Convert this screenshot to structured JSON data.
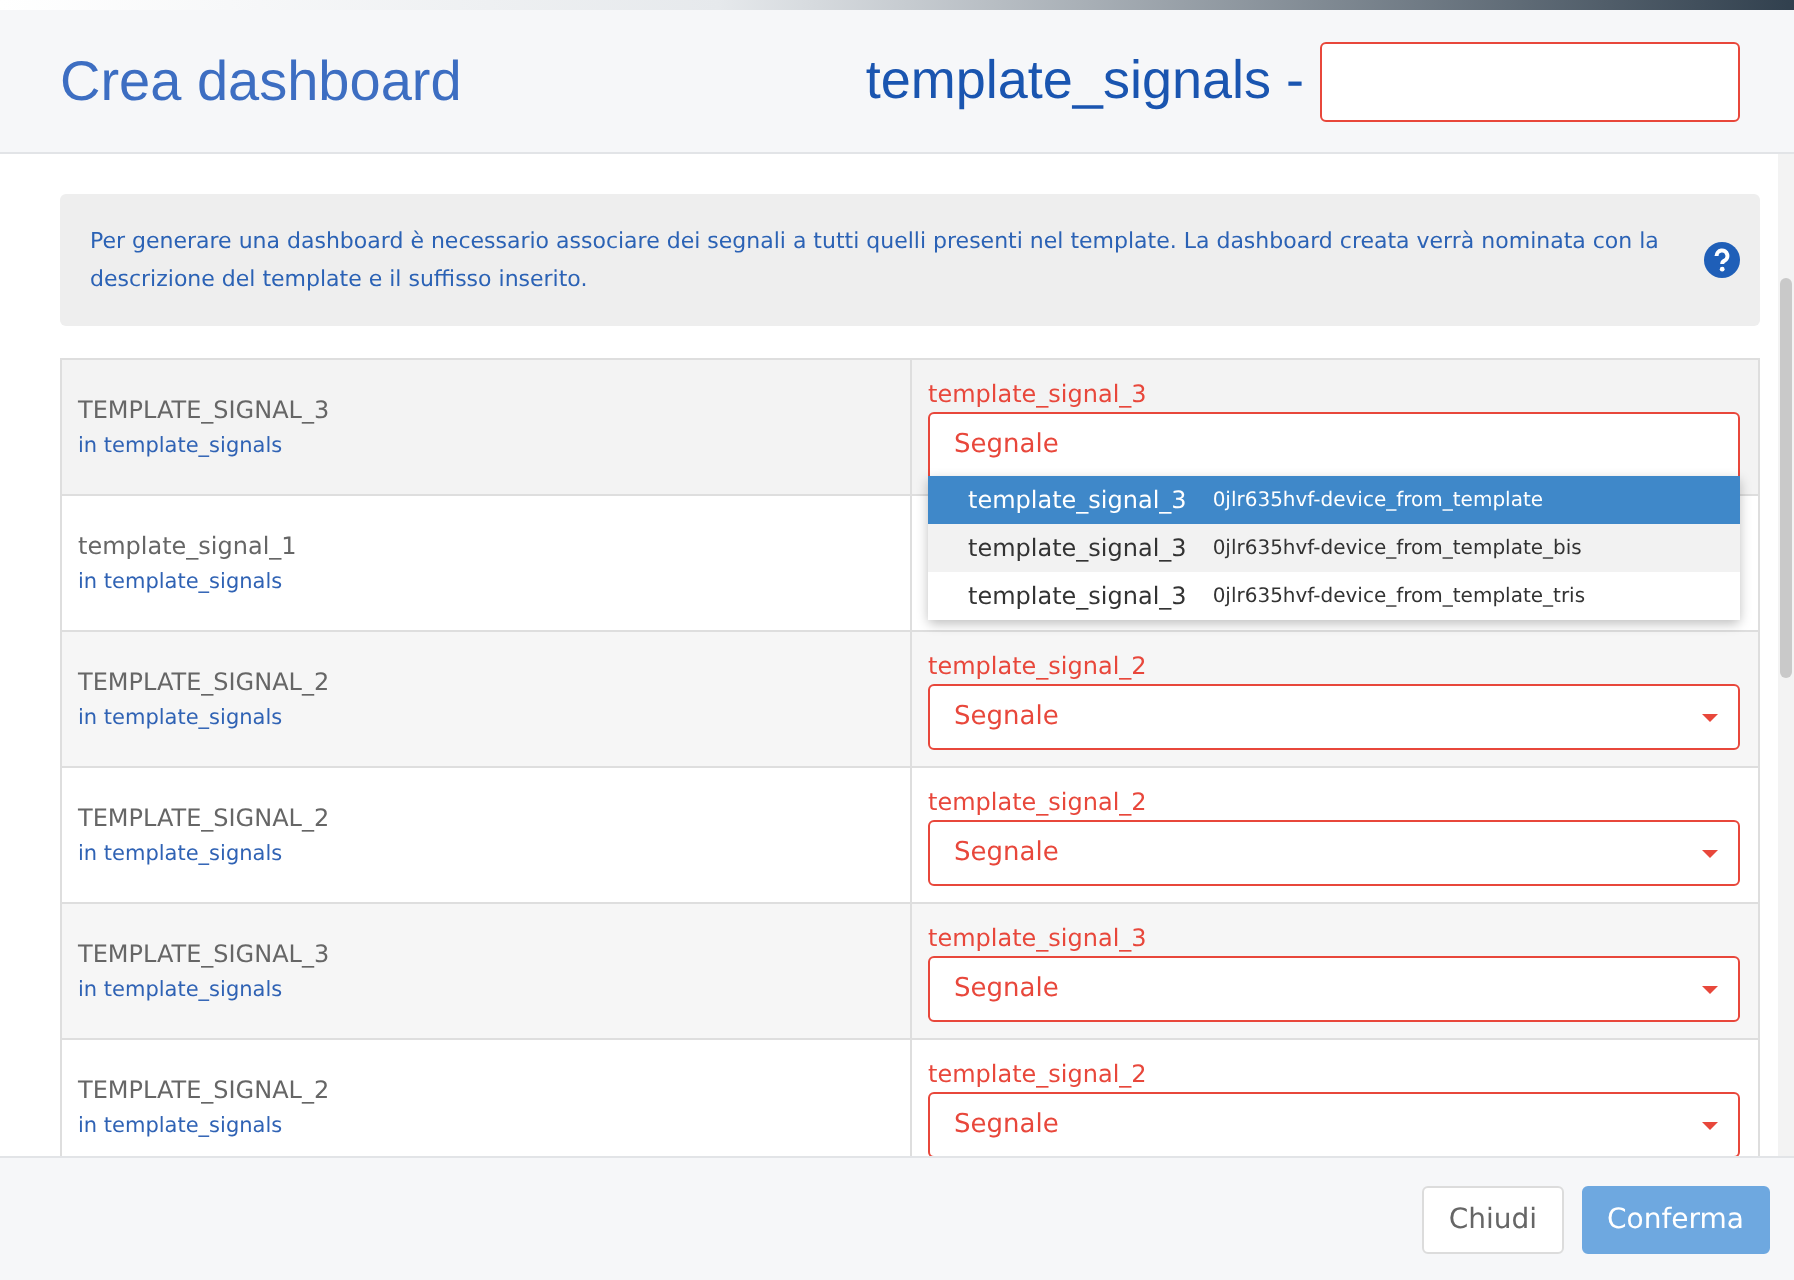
{
  "header": {
    "title": "Crea dashboard",
    "template_name": "template_signals -"
  },
  "info": {
    "text": "Per generare una dashboard è necessario associare dei segnali a tutti quelli presenti nel template. La dashboard creata verrà nominata con la descrizione del template e il suffisso inserito."
  },
  "rows": [
    {
      "name": "TEMPLATE_SIGNAL_3",
      "source": "in template_signals",
      "field_label": "template_signal_3",
      "placeholder": "Segnale",
      "open": true,
      "options": [
        {
          "signal": "template_signal_3",
          "device": "0jlr635hvf-device_from_template",
          "selected": true,
          "hovered": false
        },
        {
          "signal": "template_signal_3",
          "device": "0jlr635hvf-device_from_template_bis",
          "selected": false,
          "hovered": true
        },
        {
          "signal": "template_signal_3",
          "device": "0jlr635hvf-device_from_template_tris",
          "selected": false,
          "hovered": false
        }
      ]
    },
    {
      "name": "template_signal_1",
      "source": "in template_signals",
      "open": false
    },
    {
      "name": "TEMPLATE_SIGNAL_2",
      "source": "in template_signals",
      "field_label": "template_signal_2",
      "placeholder": "Segnale",
      "open": false
    },
    {
      "name": "TEMPLATE_SIGNAL_2",
      "source": "in template_signals",
      "field_label": "template_signal_2",
      "placeholder": "Segnale",
      "open": false
    },
    {
      "name": "TEMPLATE_SIGNAL_3",
      "source": "in template_signals",
      "field_label": "template_signal_3",
      "placeholder": "Segnale",
      "open": false
    },
    {
      "name": "TEMPLATE_SIGNAL_2",
      "source": "in template_signals",
      "field_label": "template_signal_2",
      "placeholder": "Segnale",
      "open": false
    }
  ],
  "footer": {
    "buttons": [
      {
        "label": "Chiudi",
        "kind": "secondary"
      },
      {
        "label": "Conferma",
        "kind": "primary"
      }
    ]
  }
}
